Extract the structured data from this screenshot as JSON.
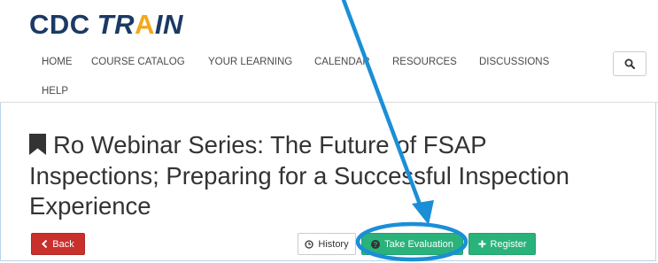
{
  "logo": {
    "cdc": "CDC",
    "train_pre": "TR",
    "train_caret": "A",
    "train_post": "IN"
  },
  "nav": {
    "items": [
      "HOME",
      "COURSE CATALOG",
      "YOUR LEARNING",
      "CALENDAR",
      "RESOURCES",
      "DISCUSSIONS",
      "HELP"
    ]
  },
  "course": {
    "title_lines": [
      "Ro Webinar Series: The Future of FSAP",
      "Inspections; Preparing for a Successful Inspection",
      "Experience"
    ]
  },
  "actions": {
    "back": "Back",
    "history": "History",
    "take_evaluation": "Take Evaluation",
    "register": "Register"
  },
  "colors": {
    "brand_navy": "#1b3a64",
    "brand_gold": "#f3a81c",
    "back_red": "#c9302c",
    "action_green": "#2ab27b",
    "annotation_blue": "#1a8fd6"
  },
  "icons": {
    "search": "search-icon",
    "bookmark": "bookmark-icon",
    "back": "chevron-left-icon",
    "history": "clock-icon",
    "evaluation": "question-circle-icon",
    "register": "plus-icon"
  }
}
